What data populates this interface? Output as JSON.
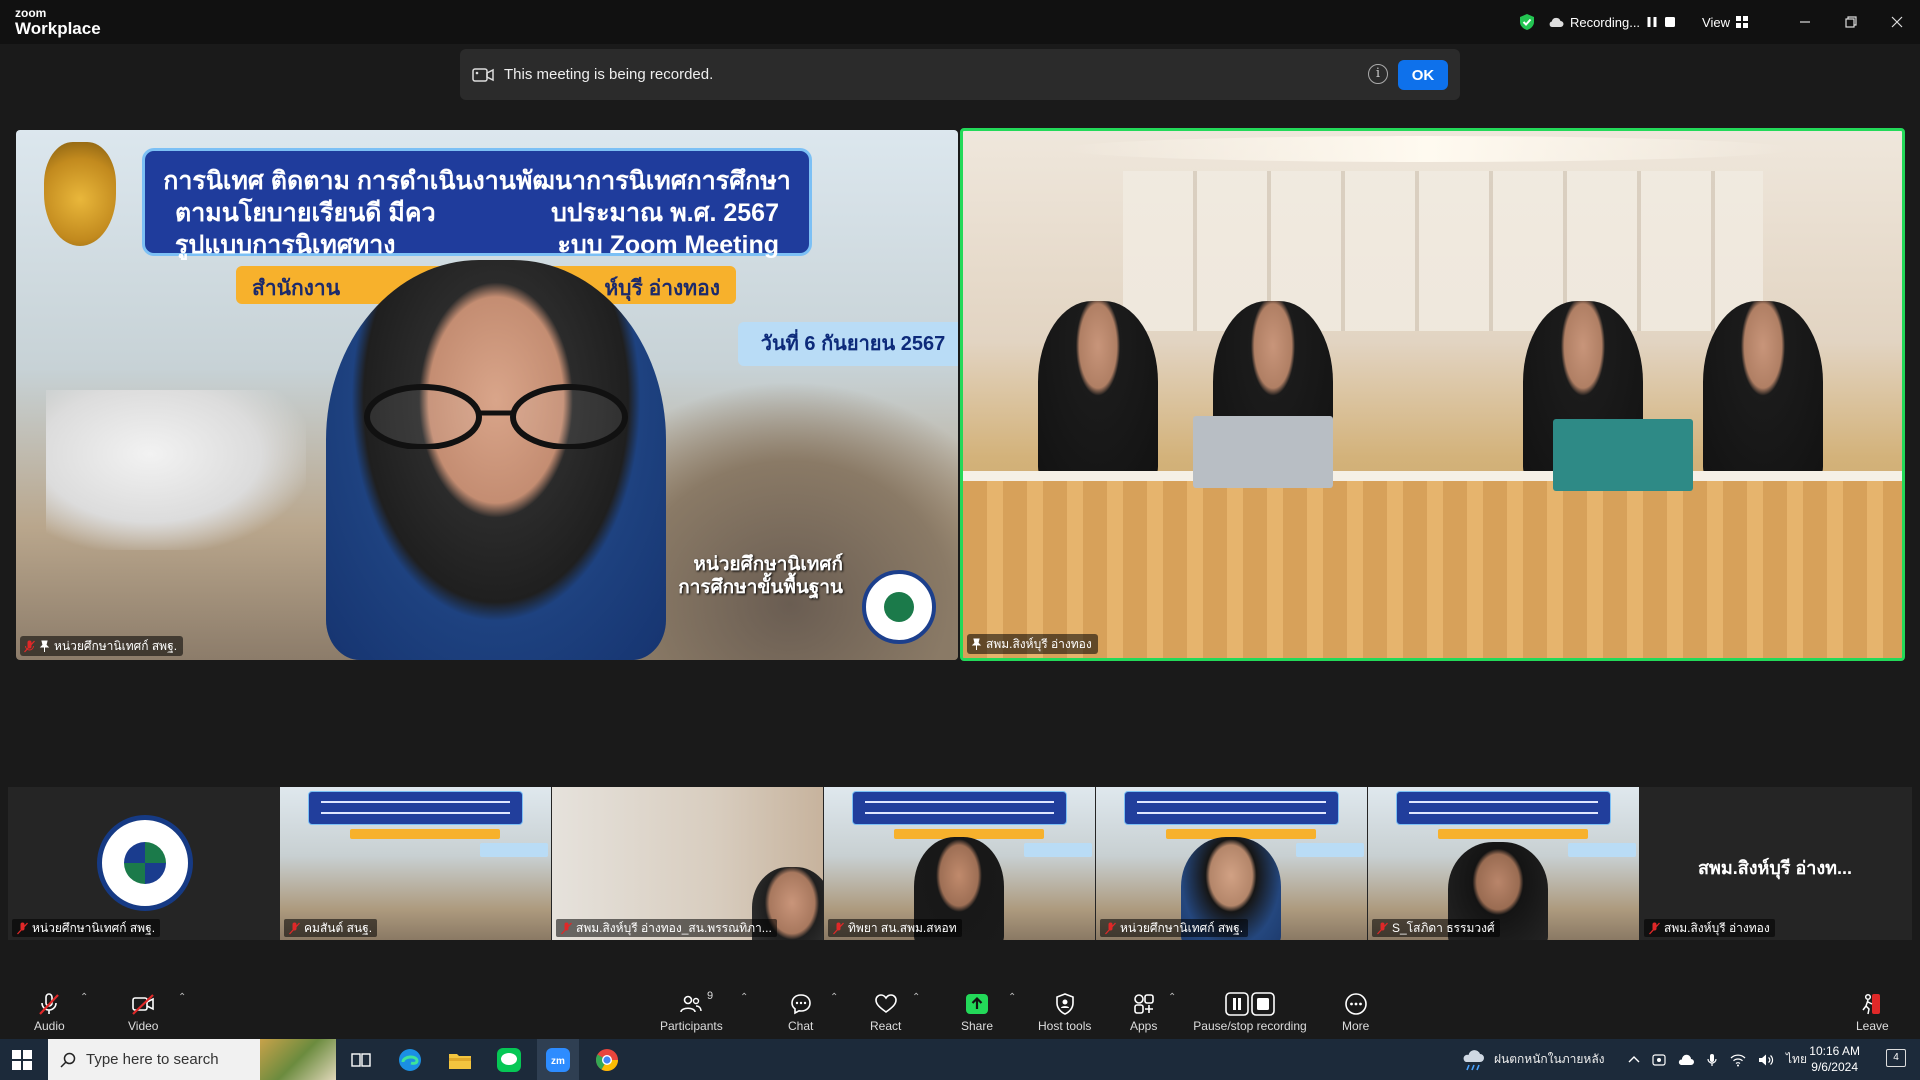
{
  "app": {
    "logo_top": "zoom",
    "logo_bottom": "Workplace",
    "recording_label": "Recording...",
    "view_label": "View"
  },
  "banner": {
    "message": "This meeting is being recorded.",
    "ok_label": "OK",
    "info_glyph": "i"
  },
  "main_videos": [
    {
      "name": "หน่วยศึกษานิเทศก์ สพฐ.",
      "slide_title_lines": [
        "การนิเทศ ติดตาม การดำเนินงานพัฒนาการนิเทศการศึกษา",
        "ตามนโยบายเรียนดี มีคว",
        "บประมาณ พ.ศ. 2567",
        "รูปแบบการนิเทศทาง",
        "ะบบ Zoom Meeting"
      ],
      "slide_org_left": "สำนักงาน",
      "slide_org_right": "ห์บุรี อ่างทอง",
      "slide_date": "วันที่ 6 กันยายน 2567",
      "unit_line1": "หน่วยศึกษานิเทศก์",
      "unit_line2": "การศึกษาขั้นพื้นฐาน"
    },
    {
      "name": "สพม.สิงห์บุรี อ่างทอง"
    }
  ],
  "thumbnails": [
    {
      "name": "หน่วยศึกษานิเทศก์ สพฐ."
    },
    {
      "name": "คมสันต์ สนฐ."
    },
    {
      "name": "สพม.สิงห์บุรี อ่างทอง_สน.พรรณทิภา..."
    },
    {
      "name": "ทิพยา สน.สพม.สหอท"
    },
    {
      "name": "หน่วยศึกษานิเทศก์ สพฐ."
    },
    {
      "name": "S_โสภิดา ธรรมวงศ์"
    },
    {
      "name": "สพม.สิงห์บุรี อ่างทอง",
      "display": "สพม.สิงห์บุรี อ่างท..."
    }
  ],
  "toolbar": {
    "audio": "Audio",
    "video": "Video",
    "participants": "Participants",
    "participants_count": "9",
    "chat": "Chat",
    "react": "React",
    "share": "Share",
    "host_tools": "Host tools",
    "apps": "Apps",
    "pause_stop": "Pause/stop recording",
    "more": "More",
    "leave": "Leave"
  },
  "taskbar": {
    "search_placeholder": "Type here to search",
    "weather": "ฝนตกหนักในภายหลัง",
    "language": "ไทย",
    "time": "10:16 AM",
    "date": "9/6/2024",
    "notifications": "4"
  },
  "colors": {
    "accent": "#0e71eb",
    "active_speaker": "#23d959",
    "share_green": "#23d959",
    "muted_red": "#e02828"
  }
}
